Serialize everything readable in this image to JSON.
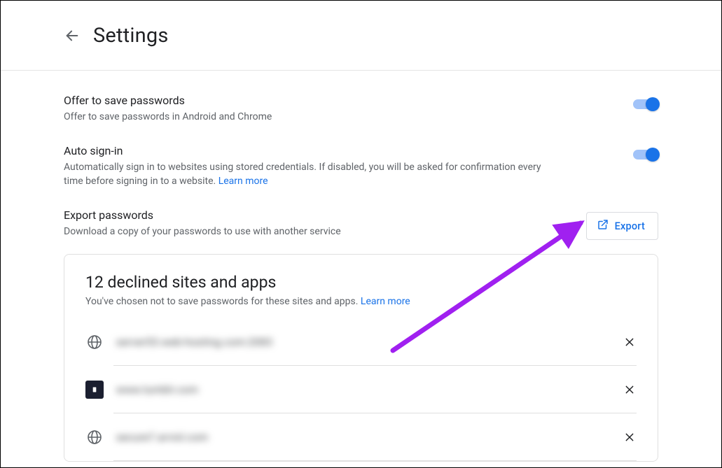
{
  "header": {
    "title": "Settings"
  },
  "rows": {
    "offer": {
      "label": "Offer to save passwords",
      "desc": "Offer to save passwords in Android and Chrome"
    },
    "auto": {
      "label": "Auto sign-in",
      "desc_pre": "Automatically sign in to websites using stored credentials. If disabled, you will be asked for confirmation every time before signing in to a website. ",
      "learn_more": "Learn more"
    },
    "export": {
      "label": "Export passwords",
      "desc": "Download a copy of your passwords to use with another service",
      "button": "Export"
    }
  },
  "declined": {
    "title": "12 declined sites and apps",
    "desc_pre": "You've chosen not to save passwords for these sites and apps. ",
    "learn_more": "Learn more",
    "sites": {
      "s1": "server53.web-hosting.com:2083",
      "s2": "www.tumblr.com",
      "s3": "secure7.arvixl.com"
    }
  },
  "colors": {
    "accent": "#1a73e8",
    "arrow": "#a020f0"
  }
}
